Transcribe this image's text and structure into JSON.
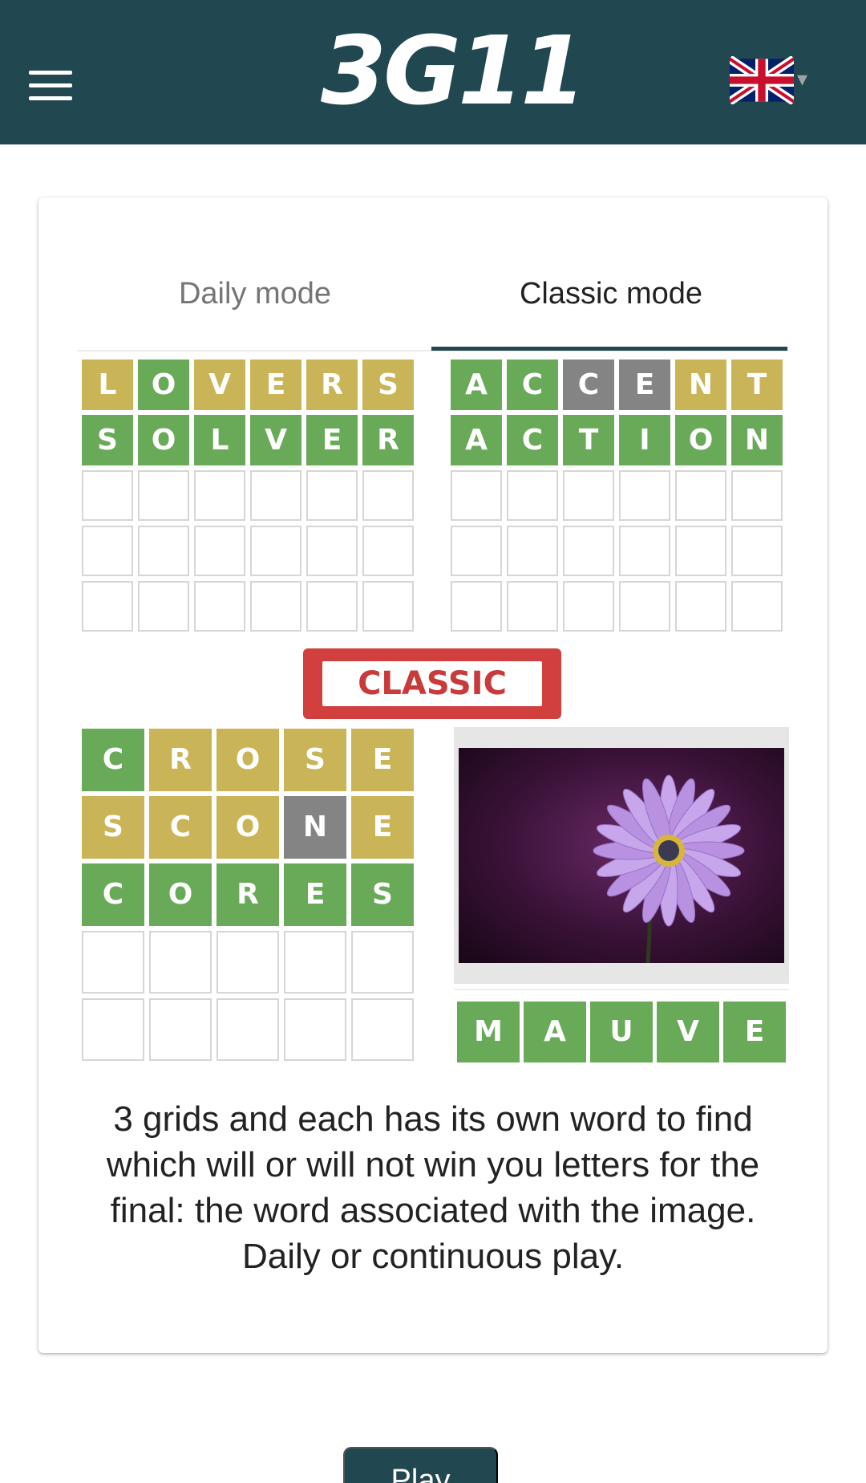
{
  "header": {
    "logo_text": "3G11",
    "background_color": "#214751",
    "menu_icon": "hamburger-menu-icon",
    "language_icon": "uk-flag-icon"
  },
  "tabs": [
    {
      "label": "Daily mode",
      "selected": false
    },
    {
      "label": "Classic mode",
      "selected": true
    }
  ],
  "grids": {
    "top_left": [
      {
        "letters": [
          "L",
          "O",
          "V",
          "E",
          "R",
          "S"
        ],
        "colors": [
          "yellow",
          "green",
          "yellow",
          "yellow",
          "yellow",
          "yellow"
        ]
      },
      {
        "letters": [
          "S",
          "O",
          "L",
          "V",
          "E",
          "R"
        ],
        "colors": [
          "green",
          "green",
          "green",
          "green",
          "green",
          "green"
        ]
      },
      {
        "letters": [
          "",
          "",
          "",
          "",
          "",
          ""
        ],
        "colors": [
          "empty",
          "empty",
          "empty",
          "empty",
          "empty",
          "empty"
        ]
      },
      {
        "letters": [
          "",
          "",
          "",
          "",
          "",
          ""
        ],
        "colors": [
          "empty",
          "empty",
          "empty",
          "empty",
          "empty",
          "empty"
        ]
      },
      {
        "letters": [
          "",
          "",
          "",
          "",
          "",
          ""
        ],
        "colors": [
          "empty",
          "empty",
          "empty",
          "empty",
          "empty",
          "empty"
        ]
      }
    ],
    "top_right": [
      {
        "letters": [
          "A",
          "C",
          "C",
          "E",
          "N",
          "T"
        ],
        "colors": [
          "green",
          "green",
          "gray",
          "gray",
          "yellow",
          "yellow"
        ]
      },
      {
        "letters": [
          "A",
          "C",
          "T",
          "I",
          "O",
          "N"
        ],
        "colors": [
          "green",
          "green",
          "green",
          "green",
          "green",
          "green"
        ]
      },
      {
        "letters": [
          "",
          "",
          "",
          "",
          "",
          ""
        ],
        "colors": [
          "empty",
          "empty",
          "empty",
          "empty",
          "empty",
          "empty"
        ]
      },
      {
        "letters": [
          "",
          "",
          "",
          "",
          "",
          ""
        ],
        "colors": [
          "empty",
          "empty",
          "empty",
          "empty",
          "empty",
          "empty"
        ]
      },
      {
        "letters": [
          "",
          "",
          "",
          "",
          "",
          ""
        ],
        "colors": [
          "empty",
          "empty",
          "empty",
          "empty",
          "empty",
          "empty"
        ]
      }
    ],
    "bottom_left": [
      {
        "letters": [
          "C",
          "R",
          "O",
          "S",
          "E"
        ],
        "colors": [
          "green",
          "yellow",
          "yellow",
          "yellow",
          "yellow"
        ]
      },
      {
        "letters": [
          "S",
          "C",
          "O",
          "N",
          "E"
        ],
        "colors": [
          "yellow",
          "yellow",
          "yellow",
          "gray",
          "yellow"
        ]
      },
      {
        "letters": [
          "C",
          "O",
          "R",
          "E",
          "S"
        ],
        "colors": [
          "green",
          "green",
          "green",
          "green",
          "green"
        ]
      },
      {
        "letters": [
          "",
          "",
          "",
          "",
          ""
        ],
        "colors": [
          "empty",
          "empty",
          "empty",
          "empty",
          "empty"
        ]
      },
      {
        "letters": [
          "",
          "",
          "",
          "",
          ""
        ],
        "colors": [
          "empty",
          "empty",
          "empty",
          "empty",
          "empty"
        ]
      }
    ]
  },
  "stamp_text": "CLASSIC",
  "image": {
    "subject": "purple daisy flower on dark purple background",
    "icon": "flower-image"
  },
  "answer": {
    "letters": [
      "M",
      "A",
      "U",
      "V",
      "E"
    ],
    "colors": [
      "green",
      "green",
      "green",
      "green",
      "green"
    ]
  },
  "description": "3 grids and each has its own word to find which will or will not win you letters for the final: the word associated with the image. Daily or continuous play.",
  "play_button": "Play",
  "colors": {
    "green": "#69aa59",
    "yellow": "#c9b458",
    "gray": "#848484",
    "accent": "#214751",
    "stamp_red": "#d13f3f"
  }
}
